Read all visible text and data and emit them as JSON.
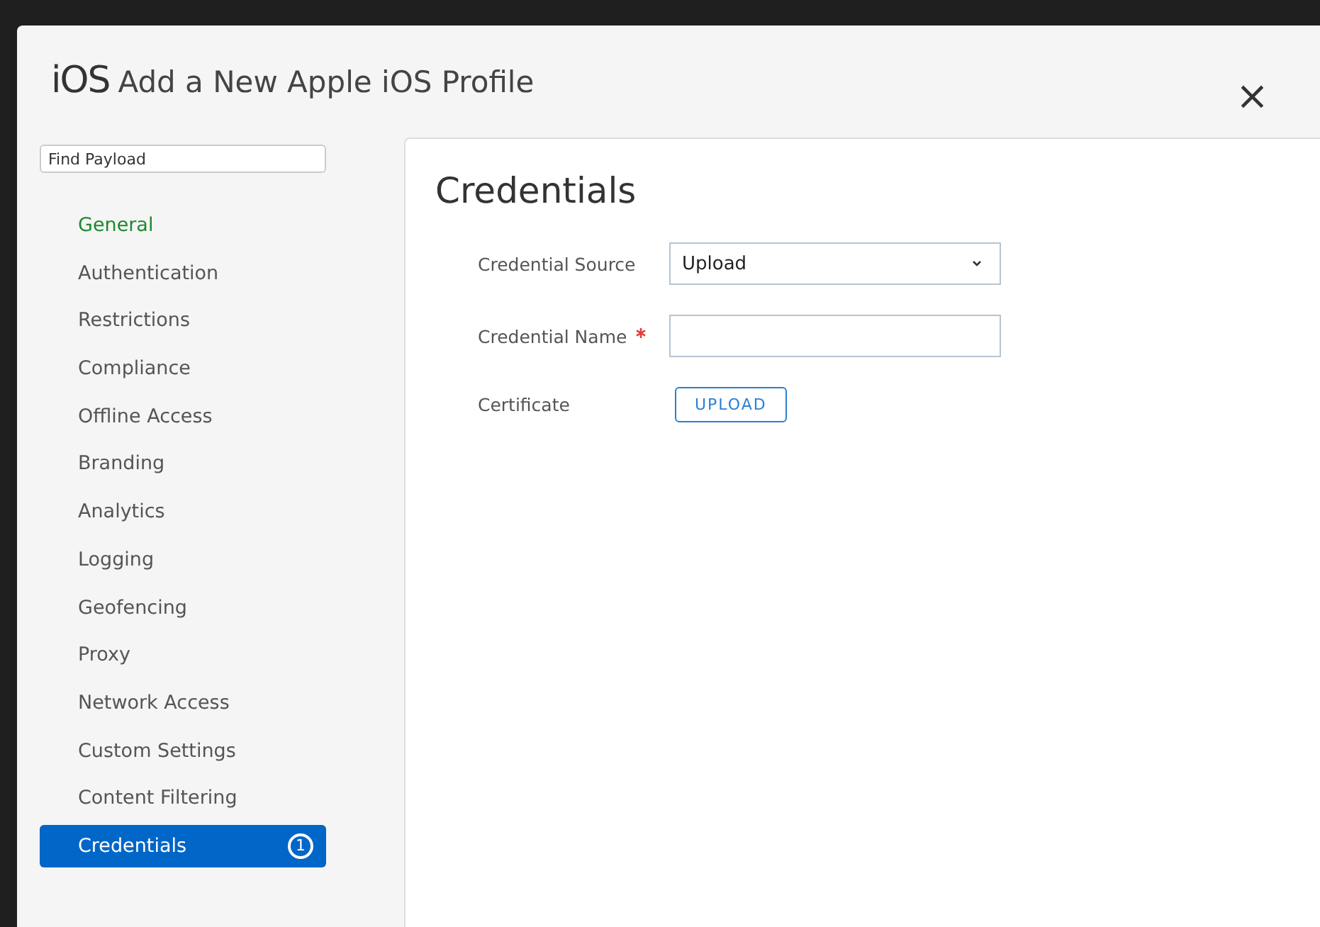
{
  "dialog": {
    "platform": "iOS",
    "title": "Add a New Apple iOS Profile",
    "close": "×"
  },
  "sidebar": {
    "search": {
      "placeholder": "Find Payload"
    },
    "items": [
      {
        "label": "General",
        "configured": true,
        "selected": false
      },
      {
        "label": "Authentication",
        "configured": false,
        "selected": false
      },
      {
        "label": "Restrictions",
        "configured": false,
        "selected": false
      },
      {
        "label": "Compliance",
        "configured": false,
        "selected": false
      },
      {
        "label": "Offline Access",
        "configured": false,
        "selected": false
      },
      {
        "label": "Branding",
        "configured": false,
        "selected": false
      },
      {
        "label": "Analytics",
        "configured": false,
        "selected": false
      },
      {
        "label": "Logging",
        "configured": false,
        "selected": false
      },
      {
        "label": "Geofencing",
        "configured": false,
        "selected": false
      },
      {
        "label": "Proxy",
        "configured": false,
        "selected": false
      },
      {
        "label": "Network Access",
        "configured": false,
        "selected": false
      },
      {
        "label": "Custom Settings",
        "configured": false,
        "selected": false
      },
      {
        "label": "Content Filtering",
        "configured": false,
        "selected": false
      },
      {
        "label": "Credentials",
        "configured": false,
        "selected": true,
        "badge": "1"
      }
    ]
  },
  "panel": {
    "heading": "Credentials",
    "fields": [
      {
        "kind": "select",
        "label": "Credential Source",
        "value": "Upload",
        "required": false
      },
      {
        "kind": "text",
        "label": "Credential Name",
        "required": true
      },
      {
        "kind": "button",
        "label": "Certificate",
        "button": "UPLOAD",
        "required": false
      }
    ]
  }
}
